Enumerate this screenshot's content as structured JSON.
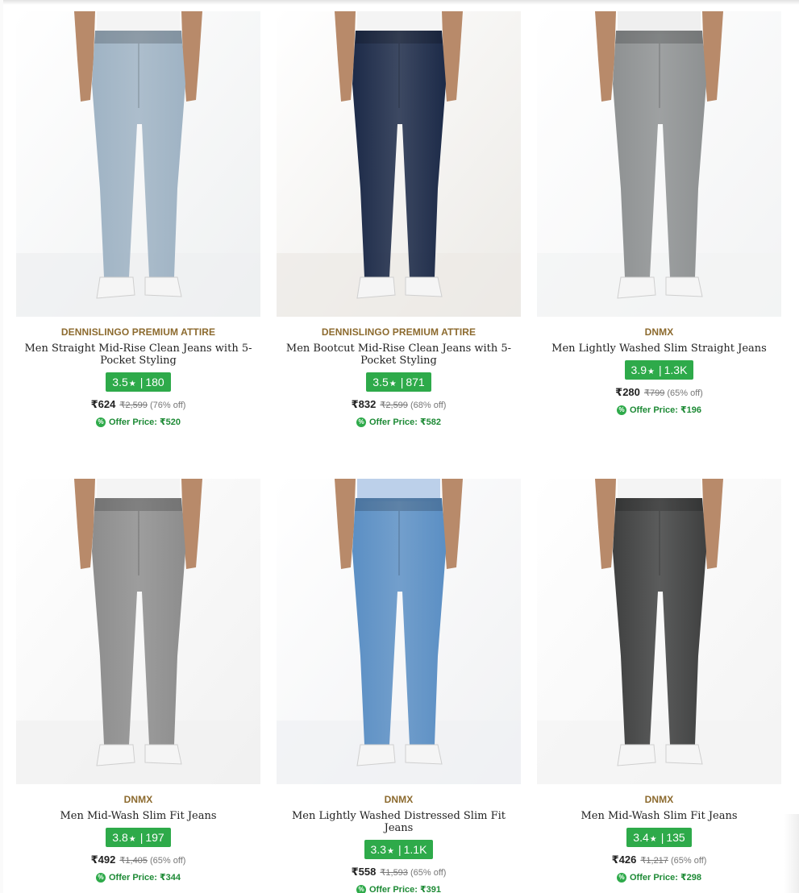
{
  "products": [
    {
      "brand": "DENNISLINGO PREMIUM ATTIRE",
      "title": "Men Straight Mid-Rise Clean Jeans with 5-Pocket Styling",
      "rating": "3.5",
      "reviews": "180",
      "price": "₹624",
      "mrp": "₹2,599",
      "discount": "(76% off)",
      "offer_price": "Offer Price: ₹520",
      "image_icon": "light-blue-jeans-photo",
      "jeans_color": "#9fb3c4"
    },
    {
      "brand": "DENNISLINGO PREMIUM ATTIRE",
      "title": "Men Bootcut Mid-Rise Clean Jeans with 5-Pocket Styling",
      "rating": "3.5",
      "reviews": "871",
      "price": "₹832",
      "mrp": "₹2,599",
      "discount": "(68% off)",
      "offer_price": "Offer Price: ₹582",
      "image_icon": "dark-indigo-jeans-photo",
      "jeans_color": "#1c2a48"
    },
    {
      "brand": "DNMX",
      "title": "Men Lightly Washed Slim Straight Jeans",
      "rating": "3.9",
      "reviews": "1.3K",
      "price": "₹280",
      "mrp": "₹799",
      "discount": "(65% off)",
      "offer_price": "Offer Price: ₹196",
      "image_icon": "grey-jeans-photo",
      "jeans_color": "#8e9192"
    },
    {
      "brand": "DNMX",
      "title": "Men Mid-Wash Slim Fit Jeans",
      "rating": "3.8",
      "reviews": "197",
      "price": "₹492",
      "mrp": "₹1,405",
      "discount": "(65% off)",
      "offer_price": "Offer Price: ₹344",
      "image_icon": "grey-jeans-photo",
      "jeans_color": "#8d8d8d"
    },
    {
      "brand": "DNMX",
      "title": "Men Lightly Washed Distressed Slim Fit Jeans",
      "rating": "3.3",
      "reviews": "1.1K",
      "price": "₹558",
      "mrp": "₹1,593",
      "discount": "(65% off)",
      "offer_price": "Offer Price: ₹391",
      "image_icon": "mid-blue-jeans-photo",
      "jeans_color": "#5b8fc4"
    },
    {
      "brand": "DNMX",
      "title": "Men Mid-Wash Slim Fit Jeans",
      "rating": "3.4",
      "reviews": "135",
      "price": "₹426",
      "mrp": "₹1,217",
      "discount": "(65% off)",
      "offer_price": "Offer Price: ₹298",
      "image_icon": "charcoal-jeans-photo",
      "jeans_color": "#3f4040"
    }
  ],
  "colors": {
    "rating_green": "#2eaa4a",
    "brand_gold": "#8c6a2e",
    "offer_green": "#1d8a35"
  }
}
